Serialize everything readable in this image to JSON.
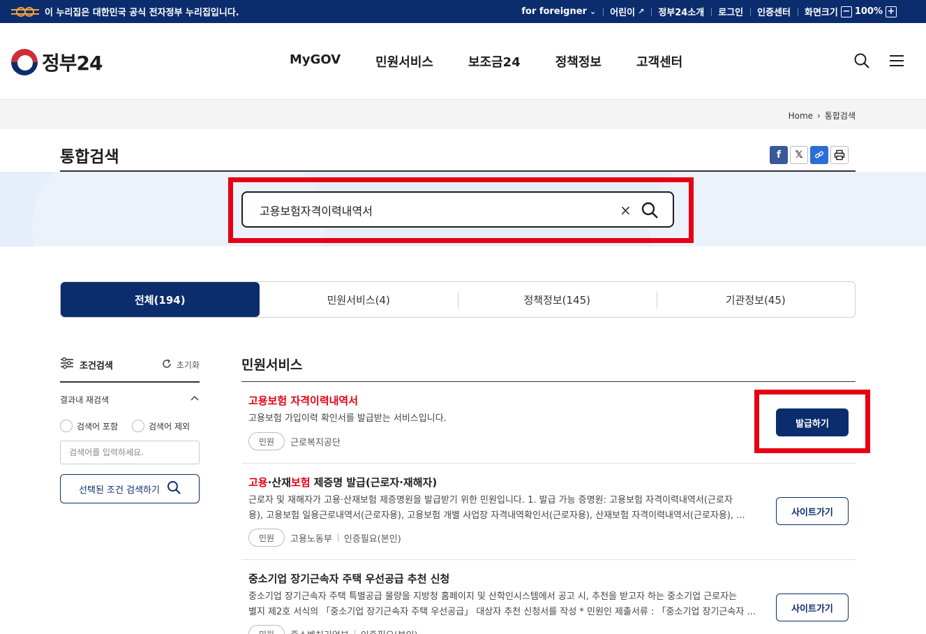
{
  "top_bar": {
    "notice": "이 누리집은 대한민국 공식 전자정부 누리집입니다.",
    "menu": [
      "for foreigner",
      "어린이",
      "정부24소개",
      "로그인",
      "인증센터",
      "화면크기"
    ],
    "zoom": "100%"
  },
  "header": {
    "logo_text": "정부24",
    "nav": [
      "MyGOV",
      "민원서비스",
      "보조금24",
      "정책정보",
      "고객센터"
    ]
  },
  "breadcrumb": [
    "Home",
    "통합검색"
  ],
  "page_title": "통합검색",
  "search": {
    "value": "고용보험자격이력내역서",
    "clear": "×"
  },
  "tabs": [
    {
      "label": "전체(194)",
      "active": true
    },
    {
      "label": "민원서비스(4)",
      "active": false
    },
    {
      "label": "정책정보(145)",
      "active": false
    },
    {
      "label": "기관정보(45)",
      "active": false
    }
  ],
  "sidebar": {
    "title": "조건검색",
    "reset": "초기화",
    "section": "결과내 재검색",
    "radio_include": "검색어 포함",
    "radio_exclude": "검색어 제외",
    "keyword_placeholder": "검색어를 입력하세요.",
    "search_button": "선택된 조건 검색하기"
  },
  "results": {
    "section_title": "민원서비스",
    "items": [
      {
        "title_parts": [
          "고용보험 자격이력내역서"
        ],
        "desc_1": "고용보험 가입이력 확인서를 발급받는 서비스입니다.",
        "desc_2": "",
        "pill": "민원",
        "agency": "근로복지공단",
        "extra": "",
        "button": "발급하기"
      },
      {
        "title_hl1": "고용",
        "title_mid": "·산재",
        "title_hl2": "보험",
        "title_rest": " 제증명 발급(근로자·재해자)",
        "desc_1": "근로자 및 재해자가 고용·산재보험 제증명원을 발급받기 위한 민원입니다. 1. 발급 가능 증명원: 고용보험 자격이력내역서(근로자",
        "desc_2": "용), 고용보험 일용근로내역서(근로자용), 고용보험 개별 사업장 자격내역확인서(근로자용), 산재보험 자격이력내역서(근로자용), ...",
        "pill": "민원",
        "agency": "고용노동부",
        "extra": "인증필요(본인)",
        "button": "사이트가기"
      },
      {
        "title": "중소기업 장기근속자 주택 우선공급 추천 신청",
        "desc_1": "중소기업 장기근속자 주택 특별공급 물량을 지방청 홈페이지 및 산학인시스템에서 공고 시, 추천을 받고자 하는 중소기업 근로자는",
        "desc_2": "별지 제2호 서식의 「중소기업 장기근속자 주택 우선공급」 대상자 추천 신청서를 작성 * 민원인 제출서류 : 「중소기업 장기근속자 ...",
        "pill": "민원",
        "agency": "중소벤처기업부",
        "extra": "인증필요(본인)",
        "button": "사이트가기"
      }
    ]
  }
}
